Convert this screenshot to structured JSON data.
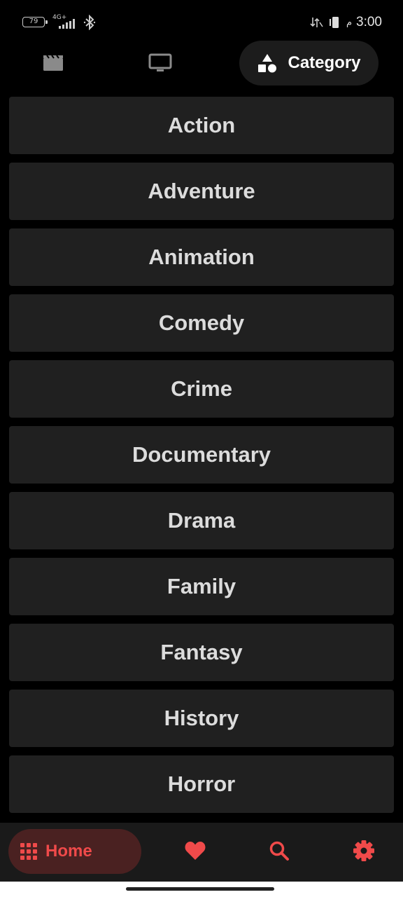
{
  "status_bar": {
    "battery": "79",
    "network_type": "4G+",
    "time": "3:00",
    "am_pm_arabic": "م"
  },
  "top_tabs": {
    "category_label": "Category"
  },
  "categories": [
    "Action",
    "Adventure",
    "Animation",
    "Comedy",
    "Crime",
    "Documentary",
    "Drama",
    "Family",
    "Fantasy",
    "History",
    "Horror"
  ],
  "bottom_nav": {
    "home_label": "Home"
  },
  "colors": {
    "accent": "#f04a4a",
    "card": "#202020",
    "background": "#000000"
  }
}
